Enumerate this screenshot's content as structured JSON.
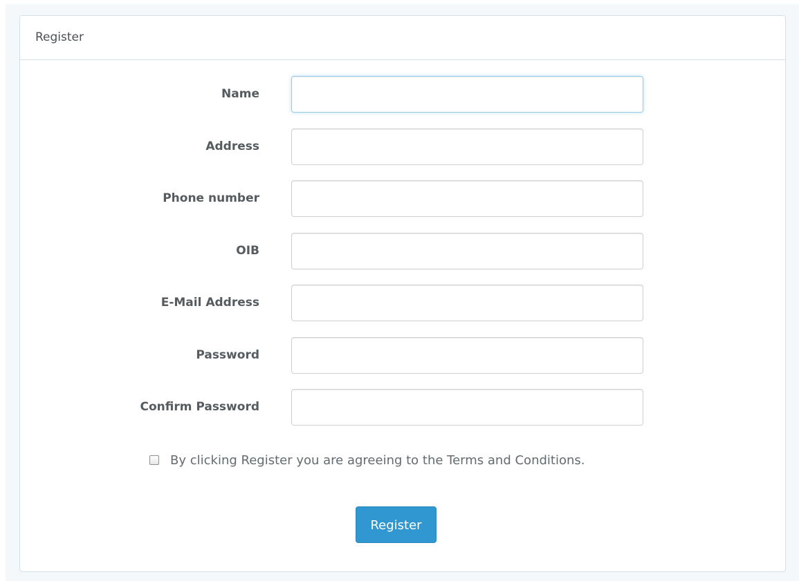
{
  "panel": {
    "title": "Register"
  },
  "form": {
    "fields": [
      {
        "label": "Name",
        "value": ""
      },
      {
        "label": "Address",
        "value": ""
      },
      {
        "label": "Phone number",
        "value": ""
      },
      {
        "label": "OIB",
        "value": ""
      },
      {
        "label": "E-Mail Address",
        "value": ""
      },
      {
        "label": "Password",
        "value": ""
      },
      {
        "label": "Confirm Password",
        "value": ""
      }
    ],
    "terms": {
      "label": "By clicking Register you are agreeing to the Terms and Conditions.",
      "checked": false
    },
    "submit_label": "Register"
  },
  "colors": {
    "page_background": "#f5f8fa",
    "panel_border": "#d3e0e9",
    "primary_button": "#3097d1",
    "focus_border": "#98cbe8"
  }
}
